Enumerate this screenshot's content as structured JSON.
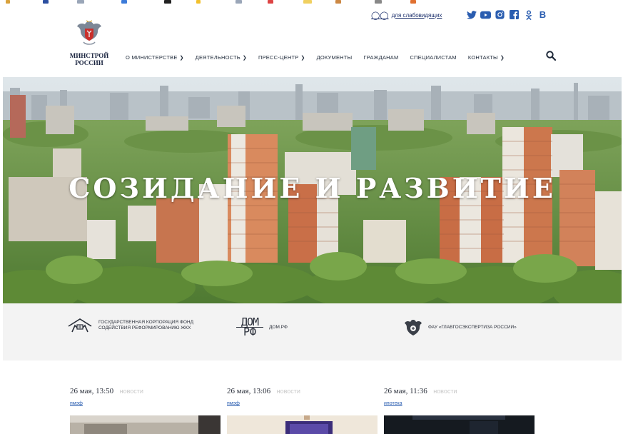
{
  "header": {
    "low_vision_label": "для слабовидящих",
    "socials": [
      "twitter-icon",
      "youtube-icon",
      "instagram-icon",
      "facebook-icon",
      "odnoklassniki-icon",
      "vk-icon"
    ],
    "vk_label": "B"
  },
  "logo": {
    "line1": "МИНСТРОЙ",
    "line2": "РОССИИ"
  },
  "menu": [
    {
      "label": "О МИНИСТЕРСТВЕ",
      "dropdown": true
    },
    {
      "label": "ДЕЯТЕЛЬНОСТЬ",
      "dropdown": true
    },
    {
      "label": "ПРЕСС-ЦЕНТР",
      "dropdown": true
    },
    {
      "label": "ДОКУМЕНТЫ",
      "dropdown": false
    },
    {
      "label": "ГРАЖДАНАМ",
      "dropdown": false
    },
    {
      "label": "СПЕЦИАЛИСТАМ",
      "dropdown": false
    },
    {
      "label": "КОНТАКТЫ",
      "dropdown": true
    }
  ],
  "hero": {
    "title": "СОЗИДАНИЕ И РАЗВИТИЕ"
  },
  "partners": [
    {
      "line1": "ГОСУДАРСТВЕННАЯ КОРПОРАЦИЯ ФОНД",
      "line2": "СОДЕЙСТВИЯ РЕФОРМИРОВАНИЮ ЖКХ",
      "icon": "house-fund-icon"
    },
    {
      "line1": "ДОМ.РФ",
      "line2": "",
      "icon": "dom-rf-logo",
      "logo_top": "ДОМ",
      "logo_bottom": "РФ"
    },
    {
      "line1": "ФАУ «ГЛАВГОСЭКСПЕРТИЗА РОССИИ»",
      "line2": "",
      "icon": "eagle-emblem-icon"
    }
  ],
  "news": [
    {
      "date": "26 мая, 13:50",
      "category": "новости",
      "tag": "пмэф"
    },
    {
      "date": "26 мая, 13:06",
      "category": "новости",
      "tag": "пмэф"
    },
    {
      "date": "26 мая, 11:36",
      "category": "новости",
      "tag": "ипотека"
    }
  ],
  "colors": {
    "accent": "#2a5db0",
    "text": "#1f2a3a",
    "partners_bg": "#f3f3f3"
  }
}
